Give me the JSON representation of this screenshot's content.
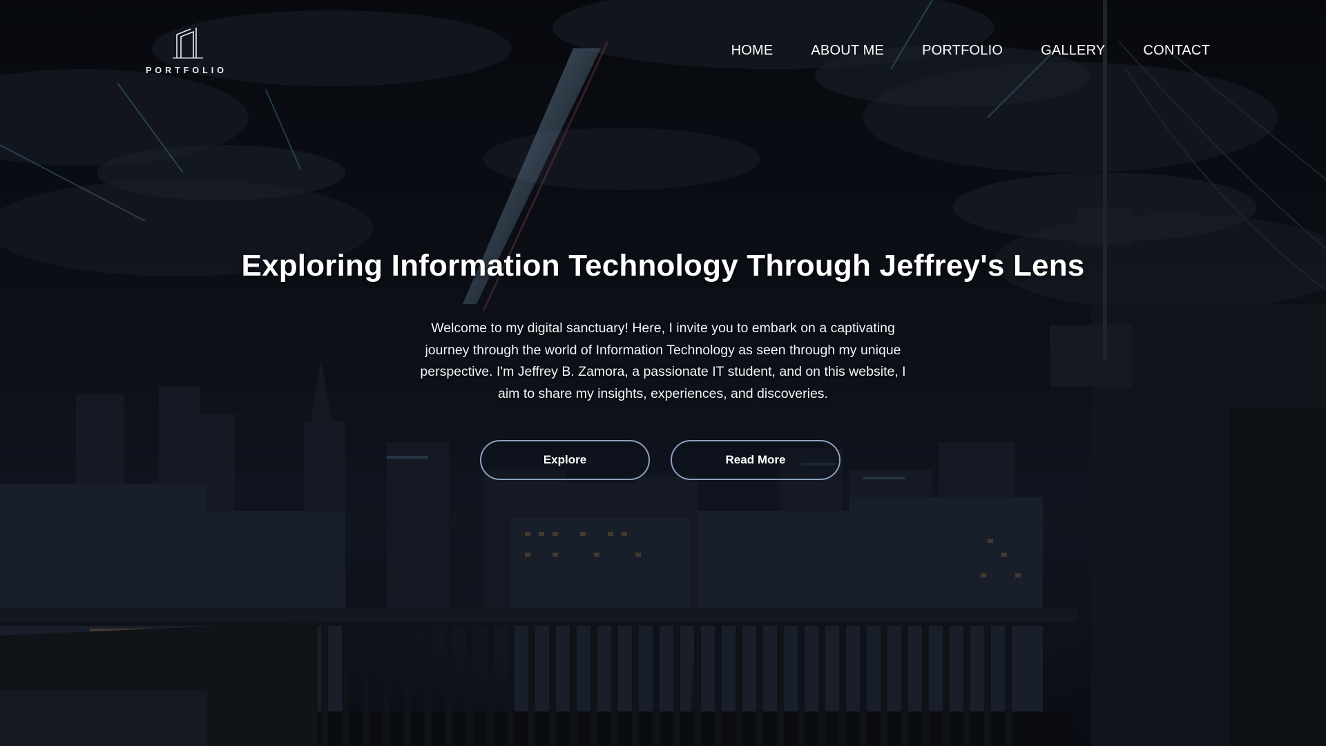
{
  "logo": {
    "text": "PORTFOLIO"
  },
  "nav": {
    "items": [
      {
        "label": "HOME"
      },
      {
        "label": "ABOUT ME"
      },
      {
        "label": "PORTFOLIO"
      },
      {
        "label": "GALLERY"
      },
      {
        "label": "CONTACT"
      }
    ]
  },
  "hero": {
    "title": "Exploring Information Technology Through Jeffrey's Lens",
    "description": "Welcome to my digital sanctuary! Here, I invite you to embark on a captivating journey through the world of Information Technology as seen through my unique perspective. I'm Jeffrey B. Zamora, a passionate IT student, and on this website, I aim to share my insights, experiences, and discoveries.",
    "buttons": {
      "explore": "Explore",
      "read_more": "Read More"
    }
  },
  "colors": {
    "sky": "#0b0f17",
    "button_border": "#8ea0c0",
    "text": "#ffffff"
  }
}
